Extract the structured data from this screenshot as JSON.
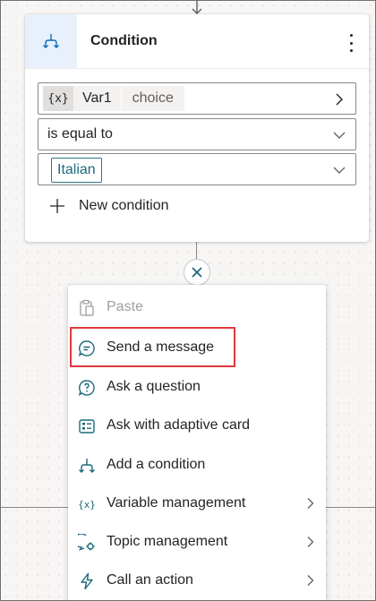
{
  "condition_card": {
    "title": "Condition",
    "variable": {
      "icon_label": "{x}",
      "name": "Var1",
      "type": "choice"
    },
    "operator": "is equal to",
    "value": "Italian",
    "new_condition_label": "New condition"
  },
  "add_menu": {
    "items": [
      {
        "label": "Paste",
        "icon": "clipboard-icon",
        "disabled": true,
        "has_submenu": false
      },
      {
        "label": "Send a message",
        "icon": "chat-bubble-icon",
        "disabled": false,
        "has_submenu": false,
        "highlighted": true
      },
      {
        "label": "Ask a question",
        "icon": "question-bubble-icon",
        "disabled": false,
        "has_submenu": false
      },
      {
        "label": "Ask with adaptive card",
        "icon": "adaptive-card-icon",
        "disabled": false,
        "has_submenu": false
      },
      {
        "label": "Add a condition",
        "icon": "branch-icon",
        "disabled": false,
        "has_submenu": false
      },
      {
        "label": "Variable management",
        "icon": "variable-icon",
        "disabled": false,
        "has_submenu": true
      },
      {
        "label": "Topic management",
        "icon": "topic-gear-icon",
        "disabled": false,
        "has_submenu": true
      },
      {
        "label": "Call an action",
        "icon": "lightning-icon",
        "disabled": false,
        "has_submenu": true
      }
    ]
  },
  "colors": {
    "accent": "#0f6cbd",
    "teal": "#1d6a7b",
    "highlight_border": "#e0393e",
    "header_icon_bg": "#e8f1fb"
  }
}
